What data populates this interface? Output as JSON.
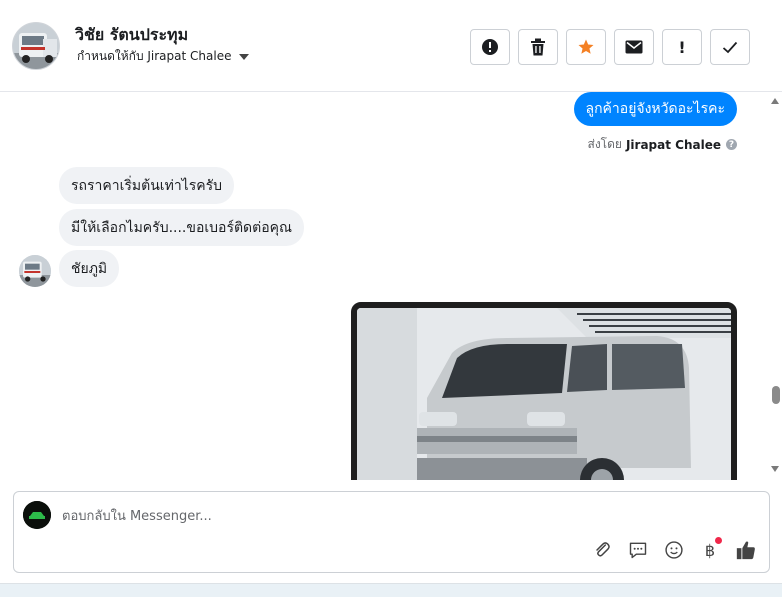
{
  "header": {
    "contact_name": "วิชัย รัตนประทุม",
    "assigned_label": "กำหนดให้กับ Jirapat Chalee",
    "actions": [
      {
        "name": "mark-spam-button",
        "icon": "alert-circle-icon",
        "title": "!"
      },
      {
        "name": "delete-button",
        "icon": "trash-icon",
        "title": ""
      },
      {
        "name": "star-button",
        "icon": "star-icon",
        "title": ""
      },
      {
        "name": "mark-unread-button",
        "icon": "envelope-icon",
        "title": ""
      },
      {
        "name": "follow-up-button",
        "icon": "exclamation-icon",
        "title": "!"
      },
      {
        "name": "mark-done-button",
        "icon": "check-icon",
        "title": ""
      }
    ]
  },
  "messages": {
    "outgoing": {
      "text": "ลูกค้าอยู่จังหวัดอะไรคะ",
      "sent_by_prefix": "ส่งโดย",
      "sent_by_name": "Jirapat Chalee",
      "info_icon": "?"
    },
    "incoming": [
      {
        "text": "รถราคาเริ่มต้นเท่าไรครับ"
      },
      {
        "text": "มีให้เลือกไมครับ....ขอเบอร์ติดต่อคุณ"
      },
      {
        "text": "ชัยภูมิ"
      }
    ]
  },
  "composer": {
    "placeholder": "ตอบกลับใน Messenger...",
    "tools": [
      {
        "name": "attach-icon",
        "glyph": "📎"
      },
      {
        "name": "saved-reply-icon",
        "glyph": "💬"
      },
      {
        "name": "emoji-icon",
        "glyph": "☺"
      },
      {
        "name": "payment-icon",
        "glyph": "฿"
      },
      {
        "name": "like-icon",
        "glyph": "👍"
      }
    ]
  },
  "colors": {
    "accent": "#0084ff",
    "incoming_bubble": "#f0f2f5",
    "star": "#f48024",
    "notification_dot": "#f0284a"
  }
}
